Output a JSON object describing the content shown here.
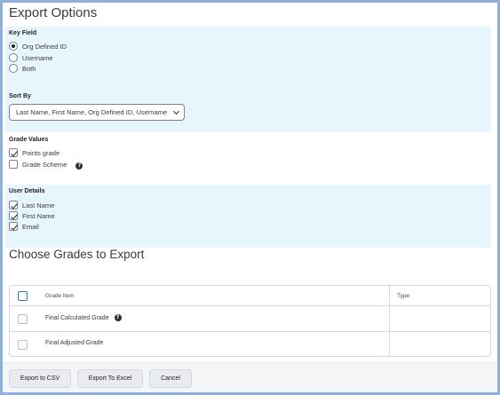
{
  "page": {
    "title": "Export Options"
  },
  "key_field": {
    "label": "Key Field",
    "options": [
      {
        "label": "Org Defined ID",
        "selected": true
      },
      {
        "label": "Username",
        "selected": false
      },
      {
        "label": "Both",
        "selected": false
      }
    ]
  },
  "sort_by": {
    "label": "Sort By",
    "value": "Last Name, First Name, Org Defined ID, Username"
  },
  "grade_values": {
    "label": "Grade Values",
    "options": [
      {
        "label": "Points grade",
        "checked": true
      },
      {
        "label": "Grade Scheme",
        "checked": false,
        "help_icon": "help-icon"
      }
    ]
  },
  "user_details": {
    "label": "User Details",
    "options": [
      {
        "label": "Last Name",
        "checked": true
      },
      {
        "label": "First Name",
        "checked": true
      },
      {
        "label": "Email",
        "checked": true
      }
    ]
  },
  "grades_section": {
    "title": "Choose Grades to Export",
    "columns": [
      "Grade Item",
      "Type"
    ],
    "rows": [
      {
        "grade_item": "Final Calculated Grade",
        "type": "",
        "checked": false,
        "help_icon": "help-icon"
      },
      {
        "grade_item": "Final Adjusted Grade",
        "type": "",
        "checked": false
      }
    ]
  },
  "footer": {
    "export_csv": "Export to CSV",
    "export_excel": "Export To Excel",
    "cancel": "Cancel"
  },
  "colors": {
    "band": "#e7f5fd",
    "border": "#8fb0d8",
    "accent": "#2a7bb5"
  }
}
